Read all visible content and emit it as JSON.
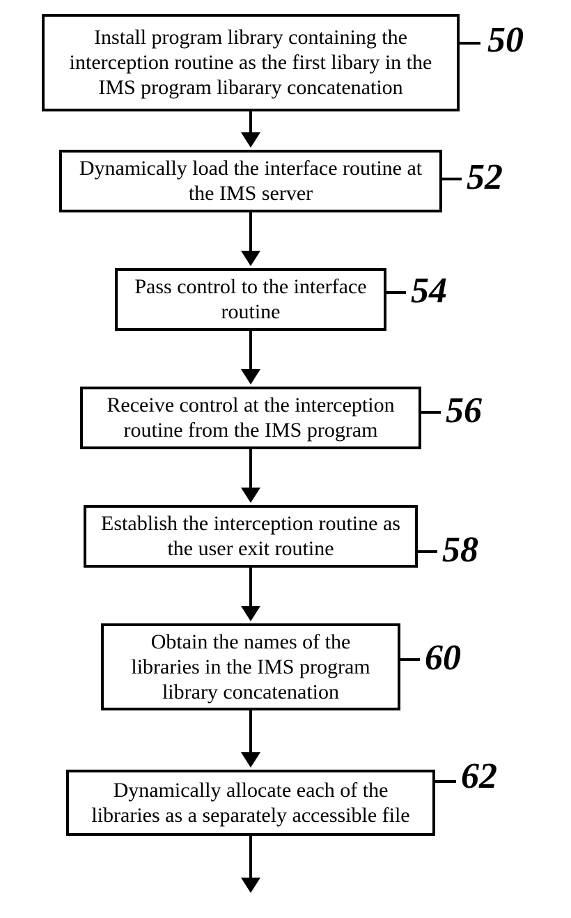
{
  "steps": [
    {
      "id": "50",
      "text": "Install program library containing the interception routine as the first libary in the IMS program libarary concatenation"
    },
    {
      "id": "52",
      "text": "Dynamically load the interface routine at the IMS server"
    },
    {
      "id": "54",
      "text": "Pass control to the interface routine"
    },
    {
      "id": "56",
      "text": "Receive control at the interception routine from the IMS program"
    },
    {
      "id": "58",
      "text": "Establish the interception routine as the user exit routine"
    },
    {
      "id": "60",
      "text": "Obtain the names of the libraries in the IMS program library concatenation"
    },
    {
      "id": "62",
      "text": "Dynamically allocate each of the libraries as a separately accessible file"
    }
  ]
}
